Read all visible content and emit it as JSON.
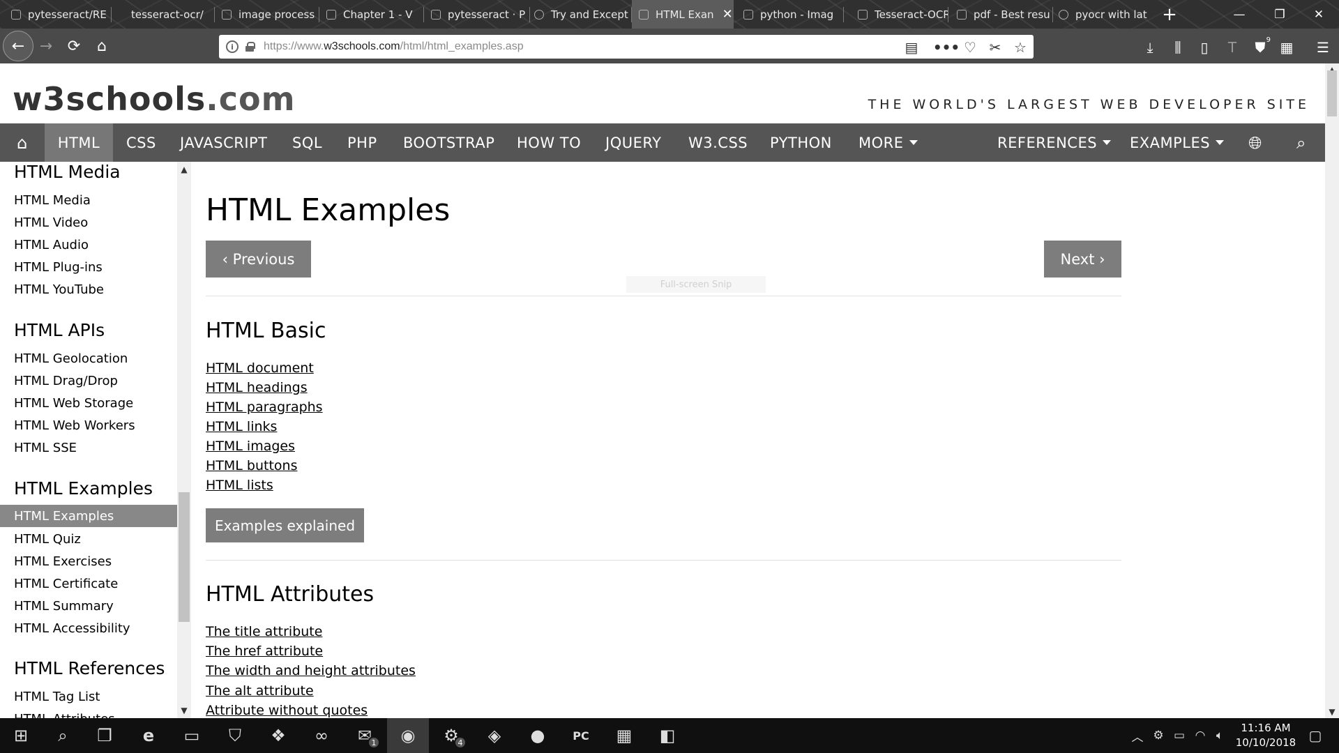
{
  "browser": {
    "tabs": [
      {
        "label": "pytesseract/RE",
        "active": false
      },
      {
        "label": "tesseract-ocr/",
        "active": false
      },
      {
        "label": "image process",
        "active": false
      },
      {
        "label": "Chapter 1 - V",
        "active": false
      },
      {
        "label": "pytesseract · P",
        "active": false
      },
      {
        "label": "Try and Except",
        "active": false
      },
      {
        "label": "HTML Exan",
        "active": true
      },
      {
        "label": "python - Imag",
        "active": false
      },
      {
        "label": "Tesseract-OCR",
        "active": false
      },
      {
        "label": "pdf - Best resu",
        "active": false
      },
      {
        "label": "pyocr with lat",
        "active": false
      }
    ],
    "url_prefix": "https://www.",
    "url_domain": "w3schools.com",
    "url_path": "/html/html_examples.asp",
    "ublock_count": "9"
  },
  "site": {
    "logo_main": "w3schools",
    "logo_tld": ".com",
    "slogan": "THE WORLD'S LARGEST WEB DEVELOPER SITE",
    "topnav": [
      "HTML",
      "CSS",
      "JAVASCRIPT",
      "SQL",
      "PHP",
      "BOOTSTRAP",
      "HOW TO",
      "JQUERY",
      "W3.CSS",
      "PYTHON",
      "MORE"
    ],
    "topnav_right": [
      "REFERENCES",
      "EXAMPLES"
    ]
  },
  "sidebar": {
    "sections": [
      {
        "heading": "HTML Media",
        "items": [
          "HTML Media",
          "HTML Video",
          "HTML Audio",
          "HTML Plug-ins",
          "HTML YouTube"
        ]
      },
      {
        "heading": "HTML APIs",
        "items": [
          "HTML Geolocation",
          "HTML Drag/Drop",
          "HTML Web Storage",
          "HTML Web Workers",
          "HTML SSE"
        ]
      },
      {
        "heading": "HTML Examples",
        "items": [
          "HTML Examples",
          "HTML Quiz",
          "HTML Exercises",
          "HTML Certificate",
          "HTML Summary",
          "HTML Accessibility"
        ]
      },
      {
        "heading": "HTML References",
        "items": [
          "HTML Tag List",
          "HTML Attributes"
        ]
      }
    ],
    "active_item": "HTML Examples"
  },
  "main": {
    "title": "HTML Examples",
    "prev_label": "‹ Previous",
    "next_label": "Next ›",
    "snip_text": "Full-screen Snip",
    "basic": {
      "heading": "HTML Basic",
      "links": [
        "HTML document",
        "HTML headings",
        "HTML paragraphs",
        "HTML links",
        "HTML images",
        "HTML buttons",
        "HTML lists"
      ],
      "button": "Examples explained"
    },
    "attributes": {
      "heading": "HTML Attributes",
      "links": [
        "The title attribute",
        "The href attribute",
        "The width and height attributes",
        "The alt attribute",
        "Attribute without quotes"
      ]
    }
  },
  "taskbar": {
    "mail_badge": "1",
    "app_badge": "4",
    "time": "11:16 AM",
    "date": "10/10/2018"
  }
}
